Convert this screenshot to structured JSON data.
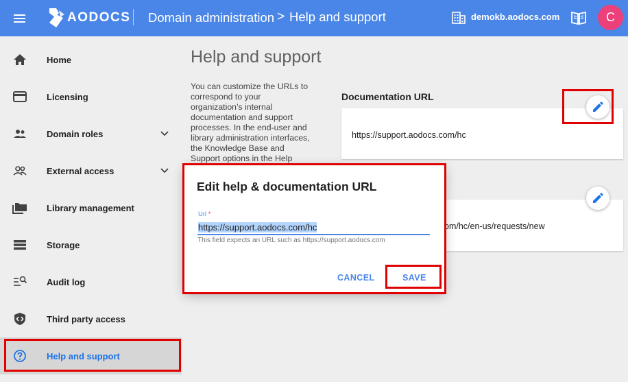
{
  "header": {
    "brand": "AODOCS",
    "breadcrumb_parent": "Domain administration",
    "breadcrumb_separator": ">",
    "breadcrumb_current": "Help and support",
    "domain": "demokb.aodocs.com",
    "avatar_initial": "C",
    "colors": {
      "bar": "#4a86e8",
      "avatar": "#ec407a"
    }
  },
  "sidebar": {
    "items": [
      {
        "label": "Home",
        "icon": "home-icon"
      },
      {
        "label": "Licensing",
        "icon": "credit-card-icon"
      },
      {
        "label": "Domain roles",
        "icon": "people-icon",
        "expandable": true
      },
      {
        "label": "External access",
        "icon": "people-outline-icon",
        "expandable": true
      },
      {
        "label": "Library management",
        "icon": "folders-icon"
      },
      {
        "label": "Storage",
        "icon": "storage-icon"
      },
      {
        "label": "Audit log",
        "icon": "audit-log-icon"
      },
      {
        "label": "Third party access",
        "icon": "shield-code-icon"
      },
      {
        "label": "Help and support",
        "icon": "help-circle-icon",
        "active": true
      }
    ]
  },
  "main": {
    "title": "Help and support",
    "description": "You can customize the URLs to correspond to your organization’s internal documentation and support processes. In the end-user and library administration interfaces, the Knowledge Base and Support options in the Help",
    "documentation": {
      "label": "Documentation URL",
      "value": "https://support.aodocs.com/hc"
    },
    "support": {
      "value_visible": "om/hc/en-us/requests/new"
    }
  },
  "dialog": {
    "title": "Edit help & documentation URL",
    "field_label": "Url",
    "required_mark": "*",
    "field_value": "https://support.aodocs.com/hc",
    "field_hint": "This field expects an URL such as https://support.aodocs.com",
    "cancel_label": "CANCEL",
    "save_label": "SAVE"
  }
}
